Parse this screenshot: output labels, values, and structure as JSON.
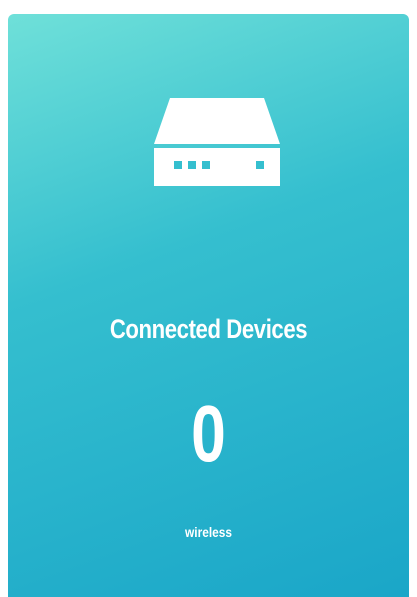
{
  "card": {
    "icon": "router-icon",
    "title": "Connected Devices",
    "count": "0",
    "subtitle": "wireless",
    "gradient_colors": [
      "#6fe0d9",
      "#35bfcf",
      "#1aa6c8"
    ]
  }
}
